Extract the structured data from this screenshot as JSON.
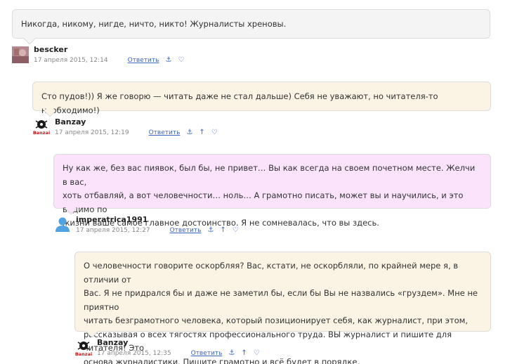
{
  "comments": [
    {
      "text": "Никогда, никому, нигде, ничто, никто! Журналисты хреновы.",
      "author": "bescker",
      "date": "17 апреля 2015, 12:14",
      "reply": "Ответить",
      "icons": [
        "anchor-icon",
        "heart-icon"
      ]
    },
    {
      "text": "Сто пудов!)) Я же говорю — читать даже не стал дальше) Себя не уважают, но читателя-то необходимо!)",
      "author": "Banzay",
      "date": "17 апреля 2015, 12:19",
      "reply": "Ответить",
      "icons": [
        "anchor-icon",
        "up-arrow-icon",
        "heart-icon"
      ]
    },
    {
      "lines": [
        "Ну как же, без вас пиявок, был бы, не привет… Вы как всегда на своем почетном месте. Желчи в вас,",
        "хоть отбавляй, а вот человечности… ноль… А грамотно писать, может вы и научились, и это видимо по",
        "жизни ваше самое главное достоинство. Я не сомневалась, что вы здесь."
      ],
      "author": "imperatrica1991",
      "date": "17 апреля 2015, 12:27",
      "reply": "Ответить",
      "icons": [
        "anchor-icon",
        "up-arrow-icon",
        "heart-icon"
      ]
    },
    {
      "lines": [
        "О человечности говорите оскорбляя? Вас, кстати, не оскорбляли, по крайней мере я, в отличии от",
        "Вас. Я не придрался бы и даже не заметил бы, если бы Вы не назвались «груздем». Мне не приятно",
        "читать безграмотного человека, который позиционирует себя, как журналист, при этом,",
        "рассказывая о всех тягостях профессионального труда. ВЫ журналист и пишите для читателя! Это",
        "основа журналистики. Пишите грамотно и всё будет в порядке."
      ],
      "author": "Banzay",
      "date": "17 апреля 2015, 12:35",
      "reply": "Ответить",
      "icons": [
        "anchor-icon",
        "up-arrow-icon",
        "heart-icon"
      ]
    }
  ],
  "avatar_logo_text": "Banzai",
  "colors": {
    "link": "#3b66c4",
    "gray_bubble": "#f4f4f4",
    "beige_bubble": "#fbf3e3",
    "pink_bubble": "#fbe3fb"
  }
}
